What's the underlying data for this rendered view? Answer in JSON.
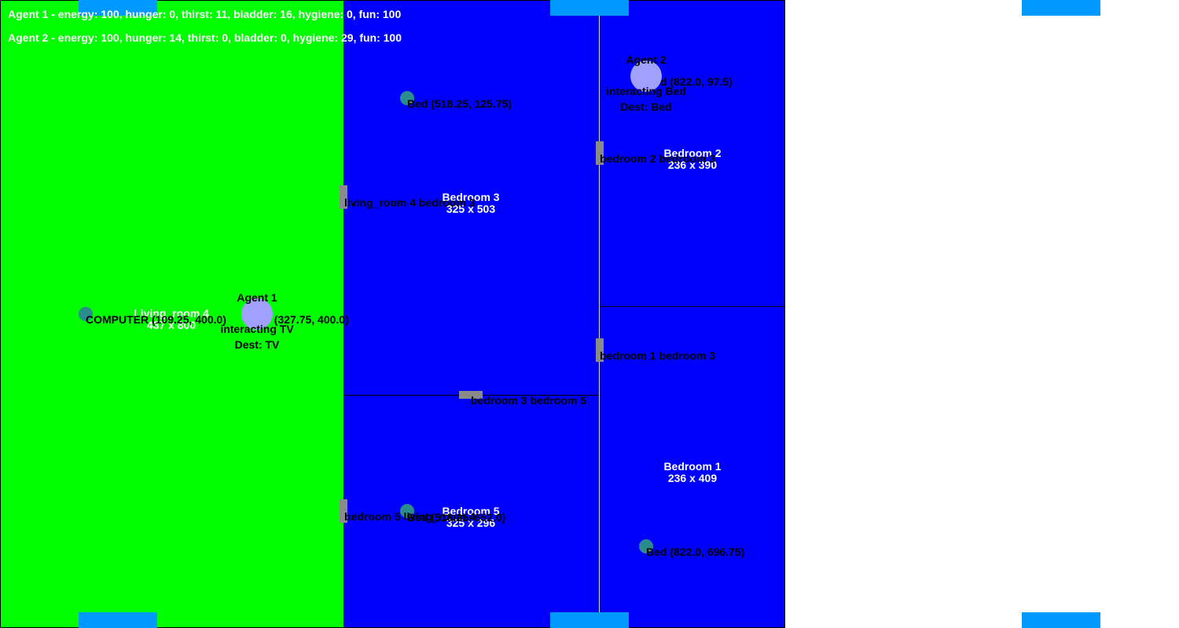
{
  "status": {
    "agent1": "Agent 1 - energy: 100, hunger: 0, thirst: 11, bladder: 16, hygiene: 0, fun: 100",
    "agent2": "Agent 2 - energy: 100, hunger: 14, thirst: 0, bladder: 0, hygiene: 29, fun: 100"
  },
  "colors": {
    "living_room": "#00ff00",
    "bedroom": "#0000ff",
    "door": "#8a8a8a",
    "agent": "#a0a0ff",
    "furniture": "#2a8c8c",
    "spawn": "#0099ff"
  },
  "rooms": {
    "living_room_4": {
      "name": "Living_room 4",
      "size": "437 x 800"
    },
    "bedroom_3": {
      "name": "Bedroom 3",
      "size": "325 x 503"
    },
    "bedroom_5": {
      "name": "Bedroom 5",
      "size": "325 x 296"
    },
    "bedroom_2": {
      "name": "Bedroom 2",
      "size": "236 x 390"
    },
    "bedroom_1": {
      "name": "Bedroom 1",
      "size": "236 x 409"
    }
  },
  "doors": {
    "living_bedroom3": "living_room 4 bedroom 3",
    "living_bedroom5": "bedroom 5 living_room 4",
    "bedroom3_bedroom5": "bedroom 3 bedroom 5",
    "bedroom2_bedroom3": "bedroom 2 bedroom 3",
    "bedroom1_bedroom3": "bedroom 1 bedroom 3"
  },
  "furniture": {
    "computer": "COMPUTER (109.25, 400.0)",
    "tv": "TV (327.75, 400.0)",
    "bed_b3": "Bed (518.25, 125.75)",
    "bed_b2": "Bed (822.0, 97.5)",
    "bed_b5": "Bed (518.25, 652.0)",
    "bed_b1": "Bed (822.0, 696.75)"
  },
  "agents": {
    "agent1": {
      "name": "Agent 1",
      "action": "interacting TV",
      "dest": "Dest: TV"
    },
    "agent2": {
      "name": "Agent 2",
      "action": "interacting Bed",
      "dest": "Dest: Bed"
    }
  }
}
